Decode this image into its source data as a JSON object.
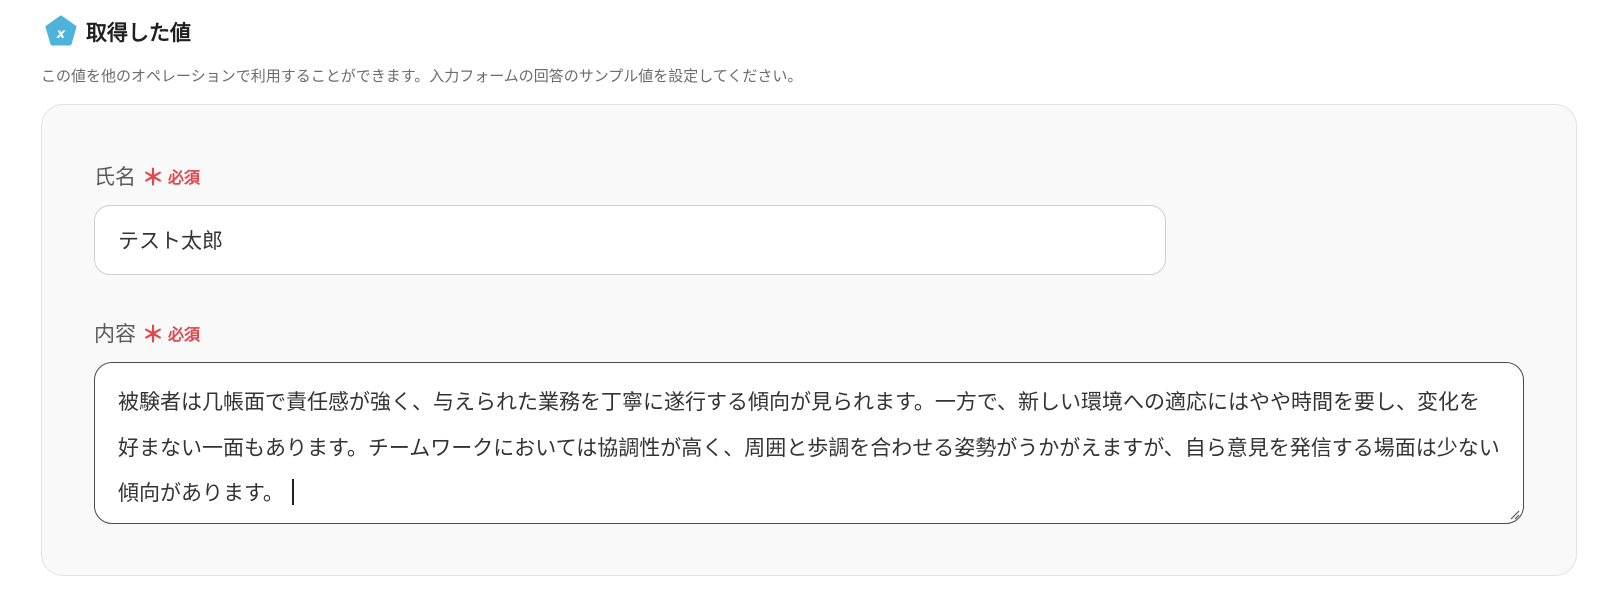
{
  "header": {
    "title": "取得した値",
    "icon": "variable-x-icon",
    "icon_color": "#4fb3d9"
  },
  "description": "この値を他のオペレーションで利用することができます。入力フォームの回答のサンプル値を設定してください。",
  "form": {
    "fields": [
      {
        "label": "氏名",
        "required_mark": "＊",
        "required_text": "必須",
        "value": "テスト太郎"
      },
      {
        "label": "内容",
        "required_mark": "＊",
        "required_text": "必須",
        "value": "被験者は几帳面で責任感が強く、与えられた業務を丁寧に遂行する傾向が見られます。一方で、新しい環境への適応にはやや時間を要し、変化を好まない一面もあります。チームワークにおいては協調性が高く、周囲と歩調を合わせる姿勢がうかがえますが、自ら意見を発信する場面は少ない傾向があります。"
      }
    ]
  },
  "colors": {
    "required": "#e0464a",
    "panel_background": "#f9f9f9"
  }
}
